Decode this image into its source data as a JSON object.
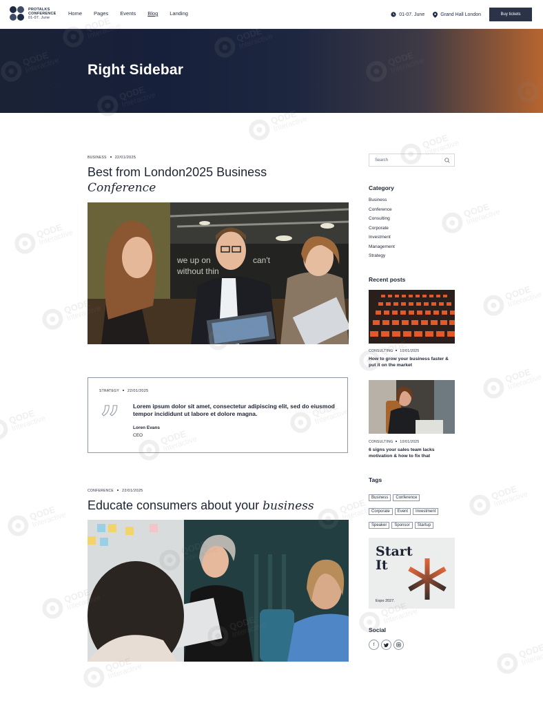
{
  "header": {
    "logo_line1": "PROTALKS",
    "logo_line2": "CONFERENCE",
    "logo_line3": "01-07. June",
    "nav": [
      "Home",
      "Pages",
      "Events",
      "Blog",
      "Landing"
    ],
    "active_nav": "Blog",
    "date": "01-07. June",
    "venue": "Grand Hall London",
    "buy_label": "Buy tickets"
  },
  "hero": {
    "title": "Right Sidebar"
  },
  "posts": [
    {
      "category": "BUSINESS",
      "date": "22/01/2025",
      "title_plain": "Best from London2025 Business",
      "title_italic": "Conference"
    },
    {
      "category": "STRATEGY",
      "date": "22/01/2025",
      "quote": "Lorem ipsum dolor sit amet, consectetur adipiscing elit, sed do eiusmod tempor incididunt ut labore et dolore magna.",
      "author": "Loren Evans",
      "role": "CEO"
    },
    {
      "category": "CONFERENCE",
      "date": "22/01/2025",
      "title_plain": "Educate consumers about your",
      "title_italic": "business"
    }
  ],
  "sidebar": {
    "search_placeholder": "Search",
    "category_heading": "Category",
    "categories": [
      "Business",
      "Conference",
      "Consulting",
      "Corporate",
      "Investment",
      "Management",
      "Strategy"
    ],
    "recent_heading": "Recent posts",
    "recent": [
      {
        "category": "CONSULTING",
        "date": "10/01/2025",
        "title": "How to grow your business faster & put it on the market"
      },
      {
        "category": "CONSULTING",
        "date": "10/01/2025",
        "title": "6 signs your sales team lacks motivation & how to fix that"
      }
    ],
    "tags_heading": "Tags",
    "tags": [
      "Business",
      "Conference",
      "Corporate",
      "Event",
      "Investment",
      "Speaker",
      "Sponsor",
      "Startup"
    ],
    "promo_title_1": "Start",
    "promo_title_2": "It",
    "promo_sub": "Expo 2027.",
    "social_heading": "Social",
    "social_icons": [
      "facebook-icon",
      "twitter-icon",
      "instagram-icon"
    ]
  },
  "watermark": {
    "brand": "QODE",
    "sub": "Interactive"
  },
  "colors": {
    "navy": "#1d2433",
    "hero_orange": "#b7652f",
    "button": "#2a3347"
  }
}
